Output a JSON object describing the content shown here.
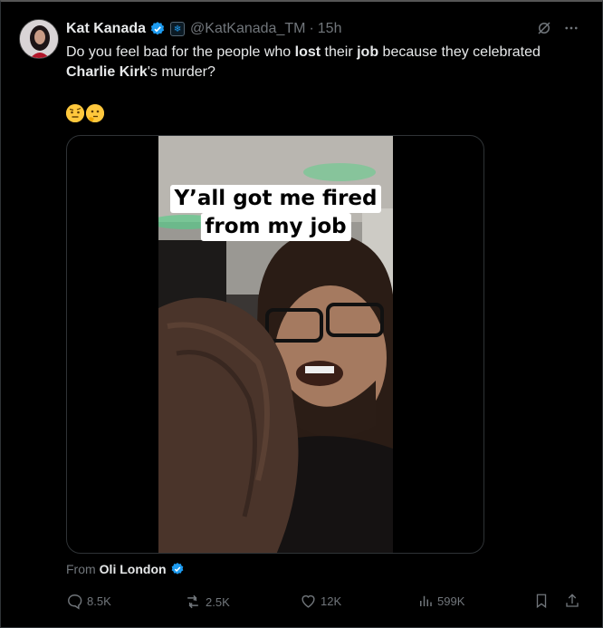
{
  "author": {
    "name": "Kat Kanada",
    "handle": "@KatKanada_TM",
    "separator": "·",
    "time": "15h"
  },
  "tweet": {
    "text_part1": "Do you feel bad for the people who ",
    "text_bold1": "lost",
    "text_part2": " their ",
    "text_bold2": "job",
    "text_part3": " because they celebrated ",
    "text_bold3": "Charlie Kirk",
    "text_part4": "'s murder?",
    "emojis": [
      "raised-eyebrow-emoji",
      "thinking-face-emoji"
    ]
  },
  "media": {
    "caption_line1": "Y’all got me fired",
    "caption_line2": "from my job"
  },
  "source": {
    "prefix": "From",
    "name": "Oli London"
  },
  "actions": {
    "replies": "8.5K",
    "reposts": "2.5K",
    "likes": "12K",
    "views": "599K"
  },
  "colors": {
    "background": "#000000",
    "text": "#e7e9ea",
    "muted": "#71767b",
    "verified": "#1d9bf0",
    "border": "#2f3336"
  }
}
